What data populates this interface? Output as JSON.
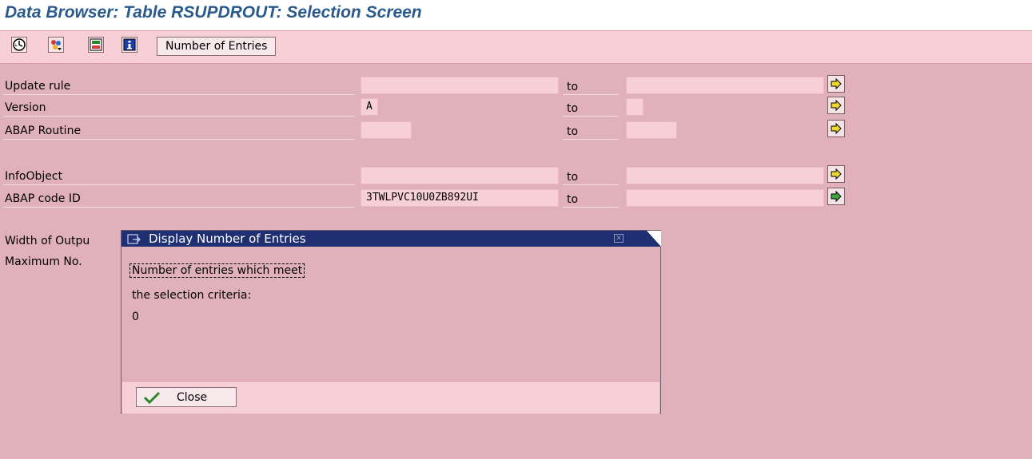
{
  "window": {
    "title": "Data Browser: Table RSUPDROUT: Selection Screen"
  },
  "toolbar": {
    "icons": [
      "execute-icon",
      "selection-options-icon",
      "save-variant-icon",
      "info-icon"
    ],
    "number_of_entries_label": "Number of Entries"
  },
  "fields": [
    {
      "label": "Update rule",
      "from": "",
      "to_label": "to",
      "to": ""
    },
    {
      "label": "Version",
      "from": "A",
      "to_label": "to",
      "to": ""
    },
    {
      "label": "ABAP Routine",
      "from": "",
      "to_label": "to",
      "to": ""
    },
    {
      "label": "InfoObject",
      "from": "",
      "to_label": "to",
      "to": ""
    },
    {
      "label": "ABAP code ID",
      "from": "3TWLPVC10U0ZB892UI",
      "to_label": "to",
      "to": ""
    }
  ],
  "output": {
    "width_label": "Width of Outpu",
    "max_label": "Maximum No."
  },
  "dialog": {
    "title": "Display Number of Entries",
    "line1": "Number of entries which meet",
    "line2": "the selection criteria:",
    "count": "0",
    "close_label": "Close"
  },
  "colors": {
    "background": "#e0b0bb",
    "toolbar": "#f7cfd6",
    "title_text": "#2a5a8c",
    "dialog_title_bar": "#1f2f72"
  }
}
